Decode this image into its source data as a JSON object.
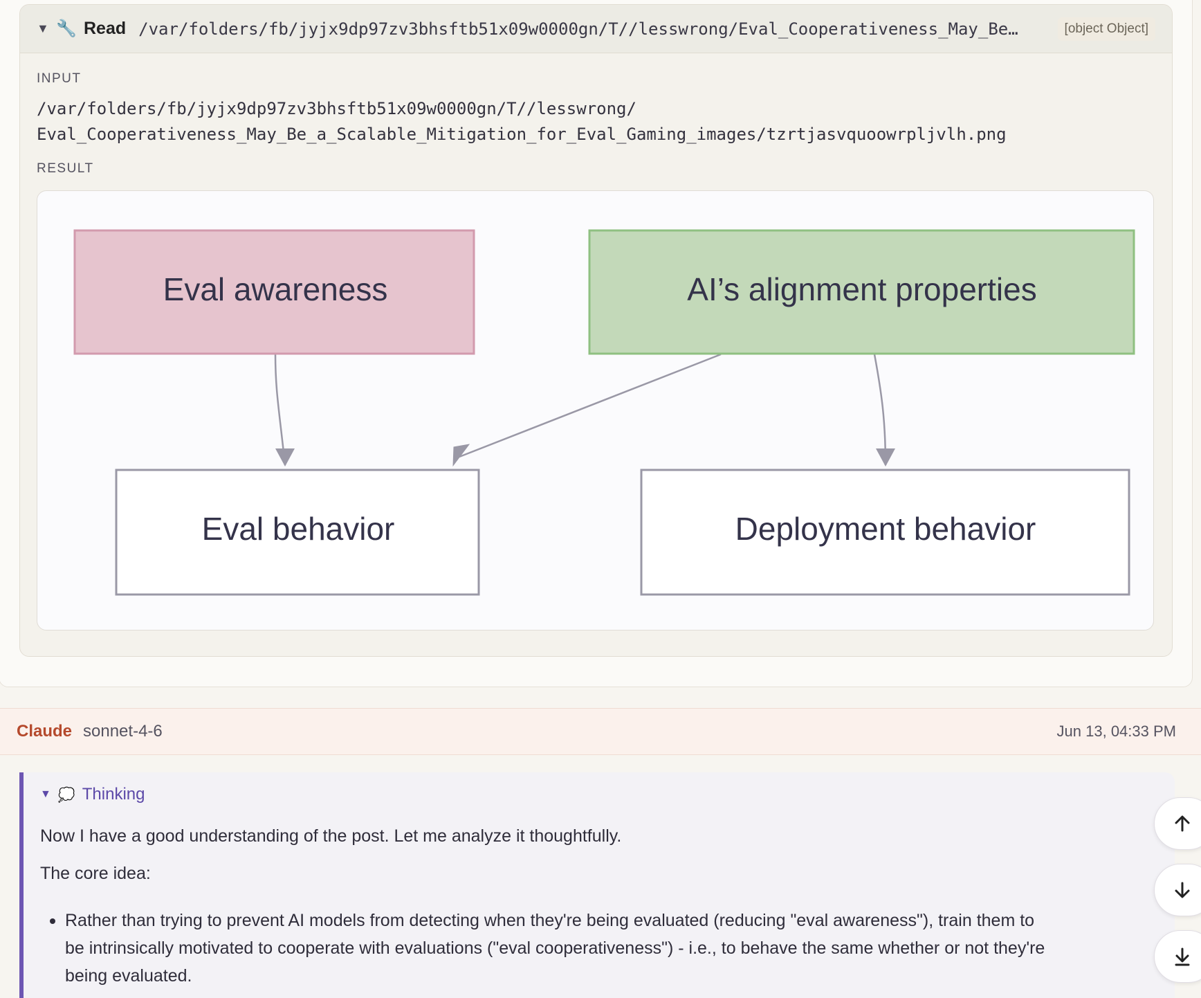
{
  "tool_call": {
    "tool_name": "Read",
    "path": "/var/folders/fb/jyjx9dp97zv3bhsftb51x09w0000gn/T//lesswrong/Eval_Cooperativeness_May_Be…",
    "badge": "[object Object]",
    "input_label": "INPUT",
    "input_line1": "/var/folders/fb/jyjx9dp97zv3bhsftb51x09w0000gn/T//lesswrong/",
    "input_line2": "Eval_Cooperativeness_May_Be_a_Scalable_Mitigation_for_Eval_Gaming_images/tzrtjasvquoowrpljvlh.png",
    "result_label": "RESULT"
  },
  "diagram": {
    "nodes": {
      "eval_awareness": "Eval awareness",
      "alignment": "AI’s alignment properties",
      "eval_behavior": "Eval behavior",
      "deployment_behavior": "Deployment behavior"
    },
    "colors": {
      "eval_awareness_fill": "#e6c4ce",
      "eval_awareness_stroke": "#d29aad",
      "alignment_fill": "#c3d9b9",
      "alignment_stroke": "#8fc081",
      "plain_fill": "#ffffff",
      "plain_stroke": "#9a98a6",
      "arrow": "#9a98a6"
    }
  },
  "message": {
    "author": "Claude",
    "model": "sonnet-4-6",
    "timestamp": "Jun 13, 04:33 PM",
    "author_color": "#b5492c"
  },
  "thinking": {
    "label": "Thinking",
    "intro": "Now I have a good understanding of the post. Let me analyze it thoughtfully.",
    "core_idea": "The core idea:",
    "bullet1_line1": "Rather than trying to prevent AI models from detecting when they're being evaluated (reducing \"eval awareness\"), train them to",
    "bullet1_line2": "be intrinsically motivated to cooperate with evaluations (\"eval cooperativeness\") - i.e., to behave the same whether or not they're",
    "bullet1_line3": "being evaluated.",
    "accent": "#6d56b3"
  },
  "icons": {
    "caret": "triangle-down",
    "tool": "wrench-icon",
    "thinking": "thought-bubble-icon",
    "scroll_up": "arrow-up-icon",
    "scroll_down": "arrow-down-icon",
    "scroll_bottom": "arrow-to-bottom-icon"
  }
}
